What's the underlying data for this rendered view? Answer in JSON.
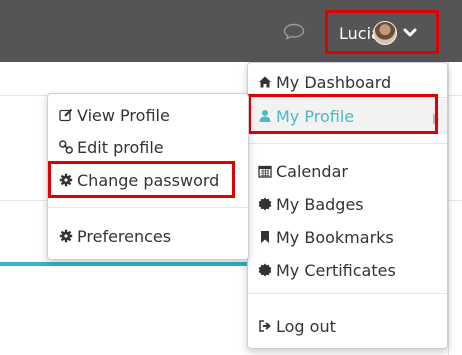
{
  "topbar": {
    "user_name": "Lucia",
    "chat_icon": "speech-bubble-icon",
    "dropdown_icon": "chevron-down-icon"
  },
  "user_menu": {
    "items": [
      {
        "label": "My Dashboard",
        "icon": "home-icon"
      },
      {
        "label": "My Profile",
        "icon": "user-icon",
        "active": true,
        "has_submenu": true
      },
      {
        "label": "Calendar",
        "icon": "calendar-icon"
      },
      {
        "label": "My Badges",
        "icon": "badge-icon"
      },
      {
        "label": "My Bookmarks",
        "icon": "bookmark-icon"
      },
      {
        "label": "My Certificates",
        "icon": "certificate-icon"
      },
      {
        "label": "Log out",
        "icon": "logout-icon"
      }
    ]
  },
  "profile_menu": {
    "items": [
      {
        "label": "View Profile",
        "icon": "edit-icon"
      },
      {
        "label": "Edit profile",
        "icon": "link-icon"
      },
      {
        "label": "Change password",
        "icon": "gear-icon"
      },
      {
        "label": "Preferences",
        "icon": "gear-icon"
      }
    ]
  },
  "colors": {
    "topbar": "#555555",
    "highlight_box": "#e00000",
    "active_item": "#4ab9c9",
    "accent_line": "#35b5c7"
  }
}
